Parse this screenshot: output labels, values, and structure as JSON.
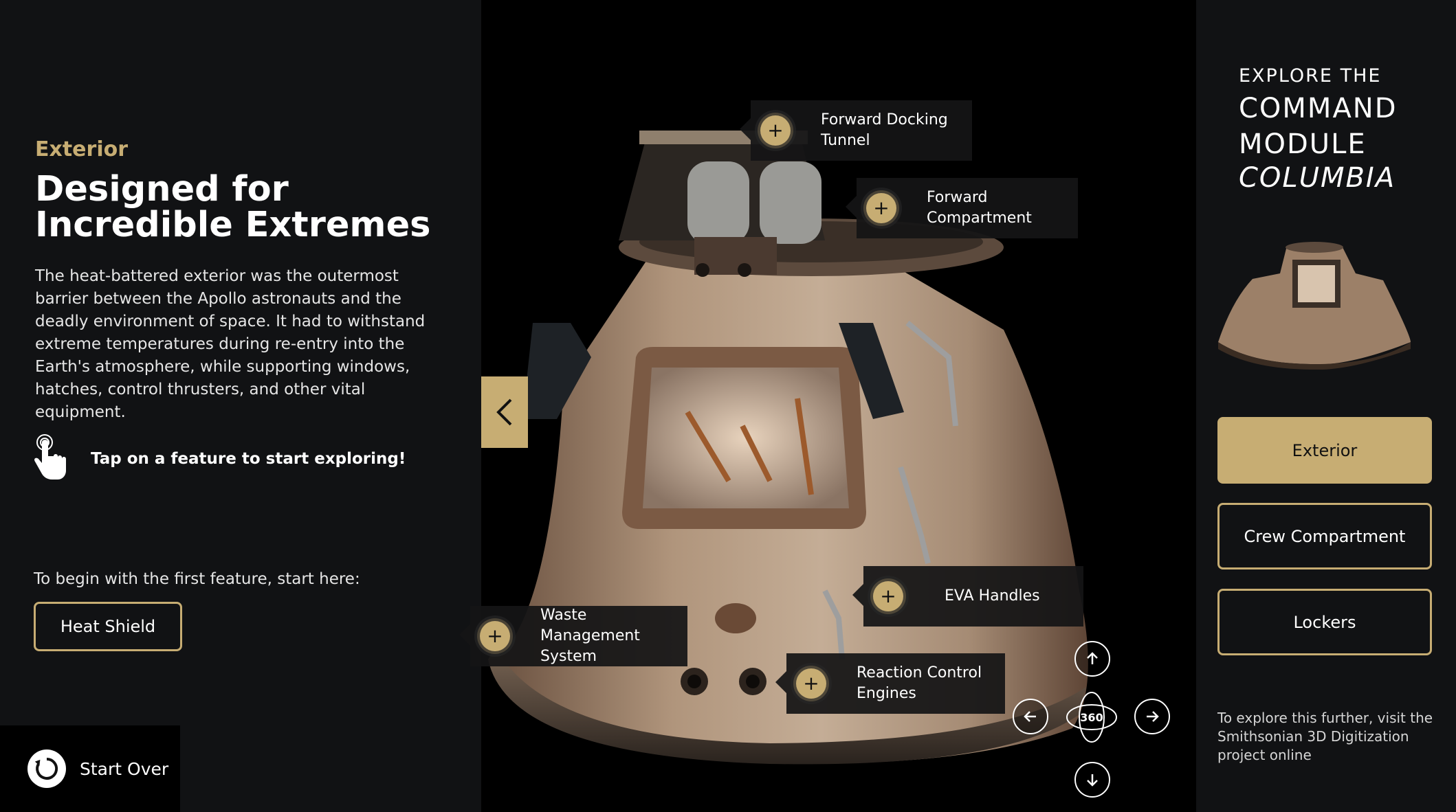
{
  "left": {
    "section_label": "Exterior",
    "headline": "Designed for Incredible Extremes",
    "body": "The heat-battered exterior was the outermost barrier between the Apollo astronauts and the deadly environment of space. It had to withstand extreme temperatures during re-entry into the Earth's atmosphere, while supporting windows, hatches, control thrusters, and other vital equipment.",
    "tap_prompt": "Tap on a feature to start exploring!",
    "begin_prompt": "To begin with the first feature, start here:",
    "first_feature_button": "Heat Shield",
    "start_over": "Start Over"
  },
  "right": {
    "explore_small": "EXPLORE THE",
    "explore_line1": "COMMAND",
    "explore_line2": "MODULE",
    "explore_italic": "COLUMBIA",
    "nav": [
      {
        "label": "Exterior",
        "active": true
      },
      {
        "label": "Crew Compartment",
        "active": false
      },
      {
        "label": "Lockers",
        "active": false
      }
    ],
    "further_text": "To explore this further, visit the Smithsonian 3D Digitization project online"
  },
  "hotspots": [
    {
      "label_line1": "Forward Docking",
      "label_line2": "Tunnel"
    },
    {
      "label_line1": "Forward",
      "label_line2": "Compartment"
    },
    {
      "label_line1": "EVA Handles",
      "label_line2": ""
    },
    {
      "label_line1": "Waste Management",
      "label_line2": "System"
    },
    {
      "label_line1": "Reaction Control",
      "label_line2": "Engines"
    }
  ],
  "controls": {
    "rotate_label": "360",
    "icons": [
      "arrow-up-icon",
      "arrow-left-icon",
      "arrow-right-icon",
      "arrow-down-icon",
      "rotate-360-icon"
    ]
  },
  "colors": {
    "accent": "#c7ad73",
    "panel": "#111214",
    "stage": "#000000"
  }
}
